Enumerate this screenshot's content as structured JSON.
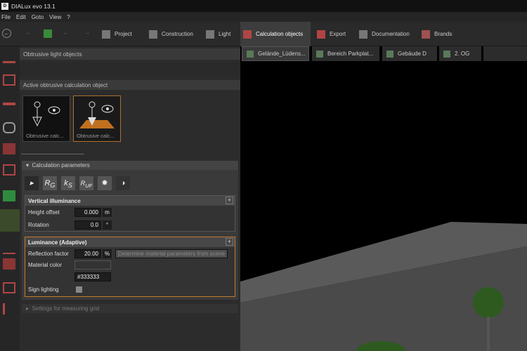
{
  "window": {
    "title": "DIALux evo 13.1",
    "logo": "D"
  },
  "menu": [
    "File",
    "Edit",
    "Goto",
    "View",
    "?"
  ],
  "tabs": [
    "Project",
    "Construction",
    "Light",
    "Calculation objects",
    "Export",
    "Documentation",
    "Brands"
  ],
  "panel": {
    "title": "Obtrusive light objects",
    "active_title": "Active obtrusive calculation object",
    "thumbs": [
      "Obtrusive calc...",
      "Obtrusive calc..."
    ],
    "calc_title": "Calculation parameters",
    "vert": {
      "title": "Vertical illuminance",
      "height_label": "Height offset",
      "height_val": "0.000",
      "height_unit": "m",
      "rot_label": "Rotation",
      "rot_val": "0.0",
      "rot_unit": "°"
    },
    "lum": {
      "title": "Luminance (Adaptive)",
      "refl_label": "Reflection factor",
      "refl_val": "20.00",
      "refl_unit": "%",
      "determine": "Determine material parameters from scene",
      "color_label": "Material color",
      "color_hex": "#333333",
      "sign_label": "Sign lighting"
    },
    "footer": "Settings for measuring grid"
  },
  "view_tabs": [
    "Gelände_Lüdens...",
    "Bereich Parkplat...",
    "Gebäude D",
    "2. OG"
  ]
}
